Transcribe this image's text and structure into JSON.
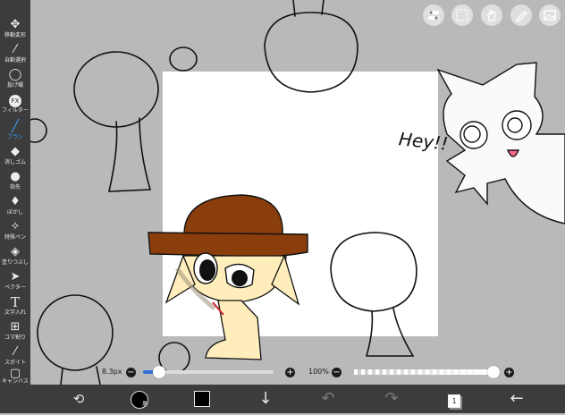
{
  "toolbar": {
    "tools": [
      {
        "label": "移動変形",
        "icon": "move-icon"
      },
      {
        "label": "自動選択",
        "icon": "magic-wand-icon"
      },
      {
        "label": "投げ縄",
        "icon": "lasso-icon"
      },
      {
        "label": "フィルター",
        "icon": "fx-icon"
      },
      {
        "label": "ブラシ",
        "icon": "brush-icon",
        "active": true
      },
      {
        "label": "消しゴム",
        "icon": "eraser-icon"
      },
      {
        "label": "指先",
        "icon": "finger-icon"
      },
      {
        "label": "ぼかし",
        "icon": "blur-drop-icon"
      },
      {
        "label": "特殊ペン",
        "icon": "special-pen-icon"
      },
      {
        "label": "塗りつぶし",
        "icon": "fill-bucket-icon"
      },
      {
        "label": "ベクター",
        "icon": "vector-arrow-icon"
      },
      {
        "label": "文字入れ",
        "icon": "text-icon"
      },
      {
        "label": "コマ割り",
        "icon": "frame-divider-icon"
      },
      {
        "label": "スポイト",
        "icon": "eyedropper-icon"
      },
      {
        "label": "キャンバス",
        "icon": "canvas-icon"
      }
    ]
  },
  "topbar": {
    "icons": [
      "toggle-panel-icon",
      "selection-icon",
      "hand-tool-icon",
      "ruler-pen-icon",
      "image-import-icon"
    ]
  },
  "sliders": {
    "brush_size": "8.3px",
    "brush_size_value": 0.12,
    "opacity": "100%",
    "opacity_value": 1.0,
    "minus": "−",
    "plus": "+"
  },
  "canvas": {
    "annotation_text": "Hey!!"
  },
  "bottombar": {
    "brush_badge": "黒",
    "layer_count": "1",
    "colors": {
      "current_color": "#000000"
    }
  },
  "colors": {
    "toolbar_bg": "#3c3c3c",
    "workspace": "#b9b9b9",
    "accent": "#3aa0ff",
    "hat": "#8a3e0c",
    "skin": "#ffeebb"
  }
}
